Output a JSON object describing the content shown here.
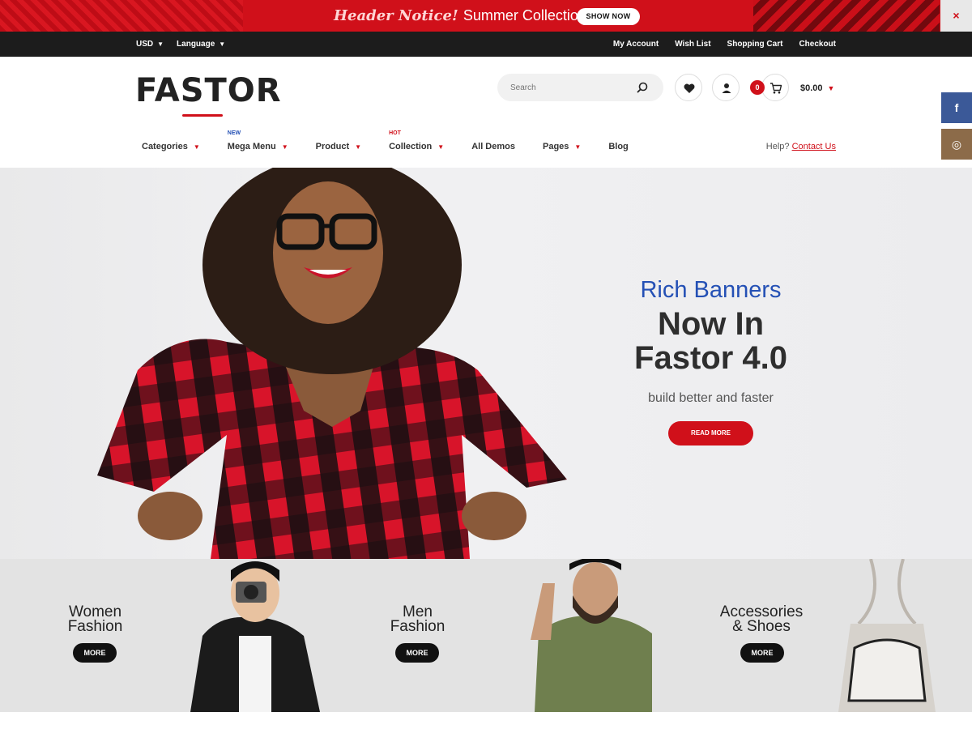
{
  "notice": {
    "brand_text": "Header Notice!",
    "message": "Summer Collection 2018",
    "button_label": "SHOW NOW",
    "close_label": "×"
  },
  "topbar": {
    "currency": "USD",
    "language": "Language",
    "links": [
      "My Account",
      "Wish List",
      "Shopping Cart",
      "Checkout"
    ]
  },
  "header": {
    "logo_text": "FASTOR",
    "search_placeholder": "Search",
    "cart_count": "0",
    "cart_total": "$0.00"
  },
  "nav": {
    "items": [
      {
        "label": "Categories",
        "tag": "",
        "has_dropdown": true
      },
      {
        "label": "Mega Menu",
        "tag": "NEW",
        "has_dropdown": true
      },
      {
        "label": "Product",
        "tag": "",
        "has_dropdown": true
      },
      {
        "label": "Collection",
        "tag": "HOT",
        "has_dropdown": true
      },
      {
        "label": "All Demos",
        "tag": "",
        "has_dropdown": false
      },
      {
        "label": "Pages",
        "tag": "",
        "has_dropdown": true
      },
      {
        "label": "Blog",
        "tag": "",
        "has_dropdown": false
      }
    ],
    "tag_colors": {
      "NEW": "#2450b5",
      "HOT": "#d0101a"
    },
    "help_text": "Help?",
    "contact_label": "Contact Us"
  },
  "social": {
    "facebook": "f",
    "instagram": "◎",
    "facebook_color": "#3b5998",
    "instagram_color": "#8c6b49"
  },
  "hero": {
    "subtitle": "Rich Banners",
    "title_line1": "Now In",
    "title_line2": "Fastor 4.0",
    "tagline": "build better and faster",
    "button_label": "READ MORE"
  },
  "categories": [
    {
      "line1": "Women",
      "line2": "Fashion",
      "button": "MORE"
    },
    {
      "line1": "Men",
      "line2": "Fashion",
      "button": "MORE"
    },
    {
      "line1": "Accessories",
      "line2": "& Shoes",
      "button": "MORE"
    }
  ],
  "colors": {
    "accent": "#d0101a",
    "dark": "#1c1c1c",
    "blue": "#2450b5"
  }
}
